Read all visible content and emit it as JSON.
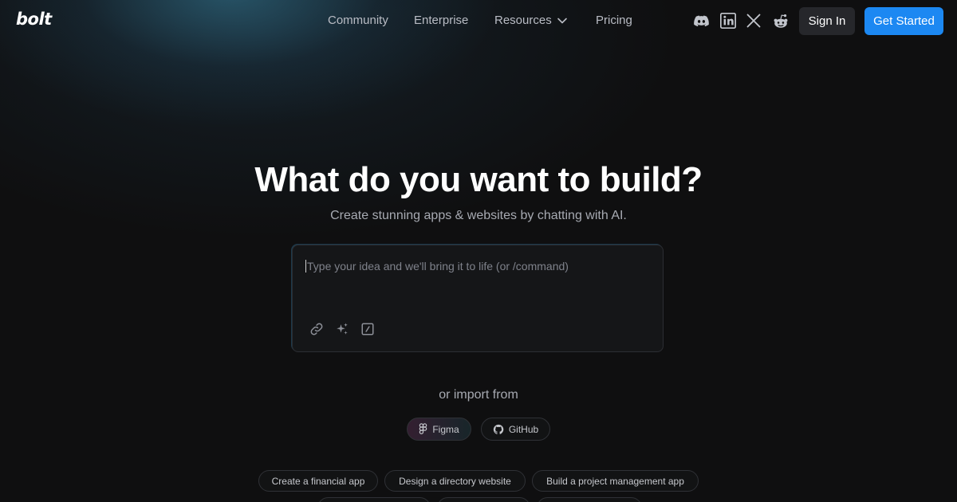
{
  "header": {
    "logo": "bolt",
    "nav": {
      "community": "Community",
      "enterprise": "Enterprise",
      "resources": "Resources",
      "pricing": "Pricing"
    },
    "social_icons": [
      "discord-icon",
      "linkedin-icon",
      "x-icon",
      "reddit-icon"
    ],
    "sign_in": "Sign In",
    "get_started": "Get Started"
  },
  "hero": {
    "title": "What do you want to build?",
    "subtitle": "Create stunning apps & websites by chatting with AI."
  },
  "prompt": {
    "value": "",
    "placeholder": "Type your idea and we'll bring it to life (or /command)",
    "tools": [
      "link-icon",
      "sparkles-icon",
      "slash-command-icon"
    ]
  },
  "import": {
    "label": "or import from",
    "figma": "Figma",
    "github": "GitHub"
  },
  "examples": [
    "Create a financial app",
    "Design a directory website",
    "Build a project management app",
    "",
    "",
    ""
  ],
  "colors": {
    "background": "#0f0f10",
    "accent": "#1c88f2",
    "glow": "#3882a0"
  }
}
